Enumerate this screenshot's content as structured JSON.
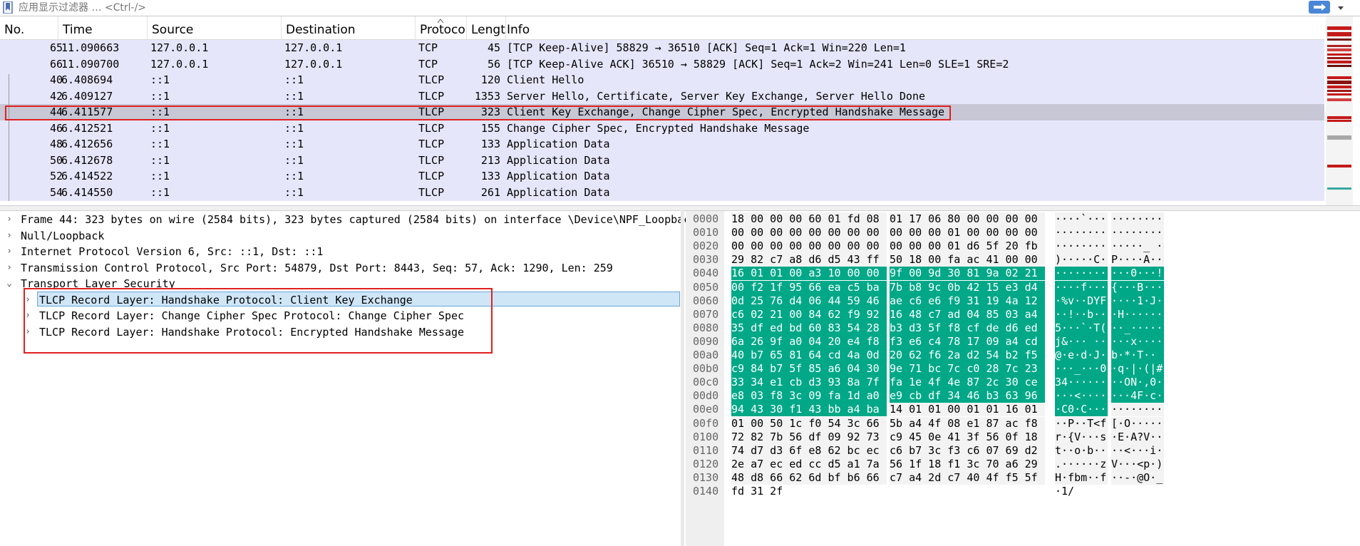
{
  "filter": {
    "placeholder": "应用显示过滤器 … <Ctrl-/>"
  },
  "columns": [
    "No.",
    "Time",
    "Source",
    "Destination",
    "Protoco",
    "Lengt",
    "Info"
  ],
  "packets": [
    {
      "no": "65",
      "time": "11.090663",
      "src": "127.0.0.1",
      "dst": "127.0.0.1",
      "proto": "TCP",
      "len": "45",
      "info": "[TCP Keep-Alive] 58829 → 36510 [ACK] Seq=1 Ack=1 Win=220 Len=1"
    },
    {
      "no": "66",
      "time": "11.090700",
      "src": "127.0.0.1",
      "dst": "127.0.0.1",
      "proto": "TCP",
      "len": "56",
      "info": "[TCP Keep-Alive ACK] 36510 → 58829 [ACK] Seq=1 Ack=2 Win=241 Len=0 SLE=1 SRE=2"
    },
    {
      "no": "40",
      "time": "6.408694",
      "src": "::1",
      "dst": "::1",
      "proto": "TLCP",
      "len": "120",
      "info": "Client Hello"
    },
    {
      "no": "42",
      "time": "6.409127",
      "src": "::1",
      "dst": "::1",
      "proto": "TLCP",
      "len": "1353",
      "info": "Server Hello, Certificate, Server Key Exchange, Server Hello Done"
    },
    {
      "no": "44",
      "time": "6.411577",
      "src": "::1",
      "dst": "::1",
      "proto": "TLCP",
      "len": "323",
      "info": "Client Key Exchange, Change Cipher Spec, Encrypted Handshake Message"
    },
    {
      "no": "46",
      "time": "6.412521",
      "src": "::1",
      "dst": "::1",
      "proto": "TLCP",
      "len": "155",
      "info": "Change Cipher Spec, Encrypted Handshake Message"
    },
    {
      "no": "48",
      "time": "6.412656",
      "src": "::1",
      "dst": "::1",
      "proto": "TLCP",
      "len": "133",
      "info": "Application Data"
    },
    {
      "no": "50",
      "time": "6.412678",
      "src": "::1",
      "dst": "::1",
      "proto": "TLCP",
      "len": "213",
      "info": "Application Data"
    },
    {
      "no": "52",
      "time": "6.414522",
      "src": "::1",
      "dst": "::1",
      "proto": "TLCP",
      "len": "133",
      "info": "Application Data"
    },
    {
      "no": "54",
      "time": "6.414550",
      "src": "::1",
      "dst": "::1",
      "proto": "TLCP",
      "len": "261",
      "info": "Application Data"
    }
  ],
  "details": [
    {
      "text": "Frame 44: 323 bytes on wire (2584 bits), 323 bytes captured (2584 bits) on interface \\Device\\NPF_Loopback",
      "expanded": false
    },
    {
      "text": "Null/Loopback",
      "expanded": false
    },
    {
      "text": "Internet Protocol Version 6, Src: ::1, Dst: ::1",
      "expanded": false
    },
    {
      "text": "Transmission Control Protocol, Src Port: 54879, Dst Port: 8443, Seq: 57, Ack: 1290, Len: 259",
      "expanded": false
    },
    {
      "text": "Transport Layer Security",
      "expanded": true
    },
    {
      "text": "TLCP Record Layer: Handshake Protocol: Client Key Exchange",
      "expanded": false
    },
    {
      "text": "TLCP Record Layer: Change Cipher Spec Protocol: Change Cipher Spec",
      "expanded": false
    },
    {
      "text": "TLCP Record Layer: Handshake Protocol: Encrypted Handshake Message",
      "expanded": false
    }
  ],
  "bytes": [
    {
      "off": "0000",
      "h1": "18 00 00 00 60 01 fd 08",
      "h2": "01 17 06 80 00 00 00 00",
      "a1": "····`···",
      "a2": "········"
    },
    {
      "off": "0010",
      "h1": "00 00 00 00 00 00 00 00",
      "h2": "00 00 00 01 00 00 00 00",
      "a1": "········",
      "a2": "········"
    },
    {
      "off": "0020",
      "h1": "00 00 00 00 00 00 00 00",
      "h2": "00 00 00 01 d6 5f 20 fb",
      "a1": "········",
      "a2": "·····_ ·"
    },
    {
      "off": "0030",
      "h1": "29 82 c7 a8 d6 d5 43 ff",
      "h2": "50 18 00 fa ac 41 00 00",
      "a1": ")·····C·",
      "a2": "P····A··"
    },
    {
      "off": "0040",
      "h1": "16 01 01 00 a3 10 00 00",
      "h2": "9f 00 9d 30 81 9a 02 21",
      "a1": "········",
      "a2": "···0···!"
    },
    {
      "off": "0050",
      "h1": "00 f2 1f 95 66 ea c5 ba",
      "h2": "7b b8 9c 0b 42 15 e3 d4",
      "a1": "····f···",
      "a2": "{···B···"
    },
    {
      "off": "0060",
      "h1": "0d 25 76 d4 06 44 59 46",
      "h2": "ae c6 e6 f9 31 19 4a 12",
      "a1": "·%v··DYF",
      "a2": "····1·J·"
    },
    {
      "off": "0070",
      "h1": "c6 02 21 00 84 62 f9 92",
      "h2": "16 48 c7 ad 04 85 03 a4",
      "a1": "··!··b··",
      "a2": "·H······"
    },
    {
      "off": "0080",
      "h1": "35 df ed bd 60 83 54 28",
      "h2": "b3 d3 5f f8 cf de d6 ed",
      "a1": "5···`·T(",
      "a2": "··_·····"
    },
    {
      "off": "0090",
      "h1": "6a 26 9f a0 04 20 e4 f8",
      "h2": "f3 e6 c4 78 17 09 a4 cd",
      "a1": "j&··· ··",
      "a2": "···x····"
    },
    {
      "off": "00a0",
      "h1": "40 b7 65 81 64 cd 4a 0d",
      "h2": "20 62 f6 2a d2 54 b2 f5",
      "a1": "@·e·d·J·",
      "a2": " b·*·T··"
    },
    {
      "off": "00b0",
      "h1": "c9 84 b7 5f 85 a6 04 30",
      "h2": "9e 71 bc 7c c0 28 7c 23",
      "a1": "···_···0",
      "a2": "·q·|·(|#"
    },
    {
      "off": "00c0",
      "h1": "33 34 e1 cb d3 93 8a 7f",
      "h2": "fa 1e 4f 4e 87 2c 30 ce",
      "a1": "34······",
      "a2": "··ON·,0·"
    },
    {
      "off": "00d0",
      "h1": "e8 03 f8 3c 09 fa 1d a0",
      "h2": "e9 cb df 34 46 b3 63 96",
      "a1": "···<····",
      "a2": "···4F·c·"
    },
    {
      "off": "00e0",
      "h1": "94 43 30 f1 43 bb a4 ba",
      "h2": "14 01 01 00 01 01 16 01",
      "a1": "·C0·C···",
      "a2": "········"
    },
    {
      "off": "00f0",
      "h1": "01 00 50 1c f0 54 3c 66",
      "h2": "5b a4 4f 08 e1 87 ac f8",
      "a1": "··P··T<f",
      "a2": "[·O·····"
    },
    {
      "off": "0100",
      "h1": "72 82 7b 56 df 09 92 73",
      "h2": "c9 45 0e 41 3f 56 0f 18",
      "a1": "r·{V···s",
      "a2": "·E·A?V··"
    },
    {
      "off": "0110",
      "h1": "74 d7 d3 6f e8 62 bc ec",
      "h2": "c6 b7 3c f3 c6 07 69 d2",
      "a1": "t··o·b··",
      "a2": "··<···i·"
    },
    {
      "off": "0120",
      "h1": "2e a7 ec ed cc d5 a1 7a",
      "h2": "56 1f 18 f1 3c 70 a6 29",
      "a1": ".······z",
      "a2": "V···<p·)"
    },
    {
      "off": "0130",
      "h1": "48 d8 66 62 6d bf b6 66",
      "h2": "c7 a4 2d c7 40 4f f5 5f",
      "a1": "H·fbm··f",
      "a2": "··-·@O·_"
    },
    {
      "off": "0140",
      "h1": "fd 31 2f",
      "h2": "",
      "a1": "·1/",
      "a2": ""
    }
  ],
  "colors": {
    "highlight": "#00a888",
    "selection_outline": "#e02020",
    "row_bg": "#e6e6fa",
    "selected_row": "#c7c7d6"
  }
}
